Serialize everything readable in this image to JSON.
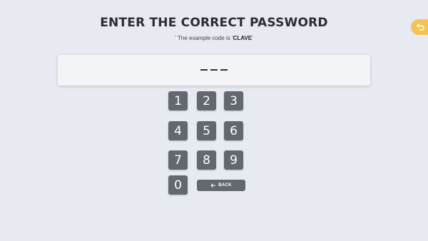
{
  "header": {
    "title": "ENTER THE CORRECT PASSWORD",
    "hint_prefix": "' The example code is '",
    "hint_code": "CLAVE",
    "hint_suffix": "'"
  },
  "undo_button": {
    "icon": "undo-arrow-icon",
    "color": "#f6c34c"
  },
  "display": {
    "slots_count": 3,
    "value": ""
  },
  "keypad": {
    "keys": [
      "1",
      "2",
      "3",
      "4",
      "5",
      "6",
      "7",
      "8",
      "9",
      "0"
    ],
    "back_label": "BACK",
    "back_icon": "arrow-left-icon",
    "key_color": "#636870"
  }
}
